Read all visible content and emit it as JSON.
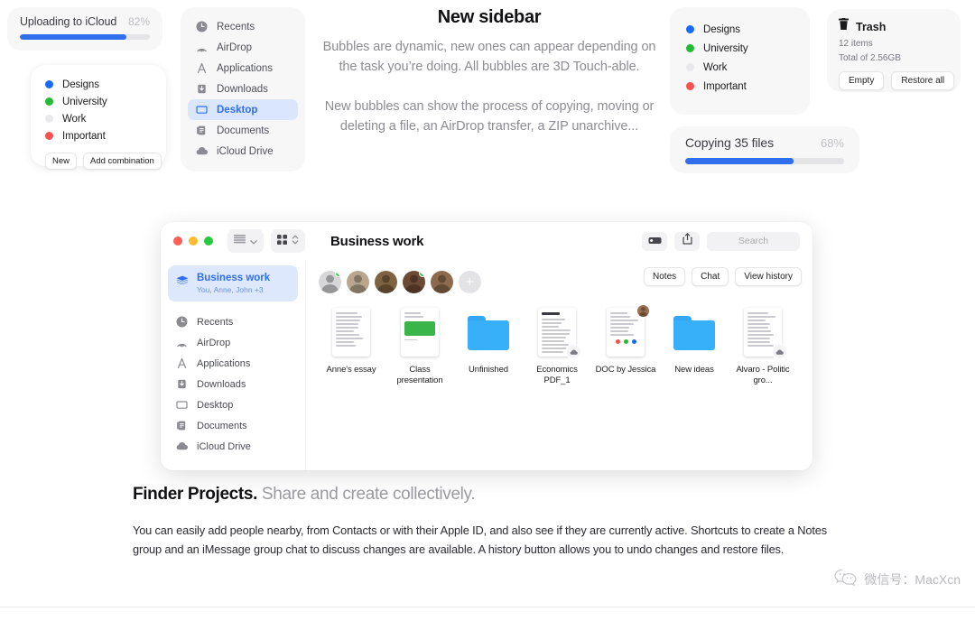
{
  "upload_card": {
    "title": "Uploading to iCloud",
    "percent_label": "82%",
    "percent": 82,
    "bar_color": "#2f6fed"
  },
  "tags_card_left": {
    "items": [
      {
        "label": "Designs",
        "color": "#1869f5"
      },
      {
        "label": "University",
        "color": "#22bb33"
      },
      {
        "label": "Work",
        "color": "#e9e9ec"
      },
      {
        "label": "Important",
        "color": "#f8514f"
      }
    ],
    "buttons": [
      {
        "label": "New"
      },
      {
        "label": "Add combination"
      }
    ]
  },
  "sidebar_card": {
    "items": [
      {
        "label": "Recents",
        "icon": "clock-icon",
        "glyph": "◕",
        "selected": false
      },
      {
        "label": "AirDrop",
        "icon": "airdrop-icon",
        "glyph": "◔",
        "selected": false
      },
      {
        "label": "Applications",
        "icon": "applications-icon",
        "glyph": "A",
        "selected": false
      },
      {
        "label": "Downloads",
        "icon": "downloads-icon",
        "glyph": "⤓",
        "selected": false
      },
      {
        "label": "Desktop",
        "icon": "desktop-icon",
        "glyph": "▭",
        "selected": true
      },
      {
        "label": "Documents",
        "icon": "documents-icon",
        "glyph": "὜8",
        "selected": false
      },
      {
        "label": "iCloud Drive",
        "icon": "icloud-icon",
        "glyph": "☁",
        "selected": false
      }
    ],
    "selected_color": "#2f6fed",
    "selected_bg": "#d9e6fd"
  },
  "center": {
    "title": "New sidebar",
    "paragraph1": "Bubbles are dynamic, new ones can appear depending on the task you’re doing. All bubbles are 3D Touch-able.",
    "paragraph2": "New bubbles can show the process of copying, moving or deleting a file, an AirDrop transfer, a ZIP unarchive..."
  },
  "tags_card_right": {
    "items": [
      {
        "label": "Designs",
        "color": "#1869f5"
      },
      {
        "label": "University",
        "color": "#22bb33"
      },
      {
        "label": "Work",
        "color": "#e9e9ec"
      },
      {
        "label": "Important",
        "color": "#f8514f"
      }
    ]
  },
  "trash_card": {
    "icon": "trash-icon",
    "title": "Trash",
    "items_count": "12 items",
    "total_size": "Total of 2.56GB",
    "buttons": [
      {
        "label": "Empty"
      },
      {
        "label": "Restore all"
      }
    ]
  },
  "copy_card": {
    "title": "Copying 35 files",
    "percent_label": "68%",
    "percent": 68,
    "bar_color": "#2f6fed"
  },
  "finder": {
    "window_title": "Business work",
    "traffic_lights": [
      "#ff5f57",
      "#febc2e",
      "#28c840"
    ],
    "toolbar": {
      "view_grid_icon": "view-grid-icon",
      "view_chevron_icon": "chevron-down-icon",
      "arrange_icon": "arrange-grid-icon",
      "sort_icon": "sort-updown-icon",
      "tag_icon": "tag-icon",
      "share_icon": "share-icon",
      "search_placeholder": "Search"
    },
    "project": {
      "icon": "stack-icon",
      "name": "Business work",
      "members": "You, Anne, John +3"
    },
    "sidebar_items": [
      {
        "label": "Recents",
        "icon": "clock-icon"
      },
      {
        "label": "AirDrop",
        "icon": "airdrop-icon"
      },
      {
        "label": "Applications",
        "icon": "applications-icon"
      },
      {
        "label": "Downloads",
        "icon": "downloads-icon"
      },
      {
        "label": "Desktop",
        "icon": "desktop-icon"
      },
      {
        "label": "Documents",
        "icon": "documents-icon"
      },
      {
        "label": "iCloud Drive",
        "icon": "icloud-icon"
      }
    ],
    "avatars": [
      {
        "name": "avatar-1",
        "online": true,
        "color": "#d7d7d9"
      },
      {
        "name": "avatar-2",
        "online": false,
        "color": "#b9a68e"
      },
      {
        "name": "avatar-3",
        "online": false,
        "color": "#7e6241"
      },
      {
        "name": "avatar-4",
        "online": true,
        "color": "#6d4a35"
      },
      {
        "name": "avatar-5",
        "online": false,
        "color": "#8d6a4d"
      }
    ],
    "add_person_label": "+",
    "action_chips": [
      {
        "label": "Notes"
      },
      {
        "label": "Chat"
      },
      {
        "label": "View history"
      }
    ],
    "files": [
      {
        "name": "Anne's essay",
        "type": "document",
        "badge": "none"
      },
      {
        "name": "Class presentation",
        "type": "presentation",
        "badge": "none",
        "heading": "Business presentation"
      },
      {
        "name": "Unfinished",
        "type": "folder",
        "badge": "none"
      },
      {
        "name": "Economics PDF_1",
        "type": "document",
        "badge": "cloud",
        "heading": "World economy 2020"
      },
      {
        "name": "DOC by Jessica",
        "type": "document",
        "badge": "avatar",
        "dots": [
          "#f8514f",
          "#22bb33",
          "#1869f5"
        ]
      },
      {
        "name": "New ideas",
        "type": "folder",
        "badge": "none"
      },
      {
        "name": "Alvaro - Politic gro...",
        "type": "document",
        "badge": "cloud"
      }
    ]
  },
  "bottom": {
    "title_bold": "Finder Projects.",
    "title_light": " Share and create collectively.",
    "paragraph": "You can easily add people nearby, from Contacts or with their Apple ID, and also see if they are currently active. Shortcuts to create a Notes group and an iMessage group chat to discuss changes are available. A history button allows you to undo changes and restore files."
  },
  "watermark": {
    "icon": "wechat-icon",
    "text": "微信号：MacXcn"
  }
}
